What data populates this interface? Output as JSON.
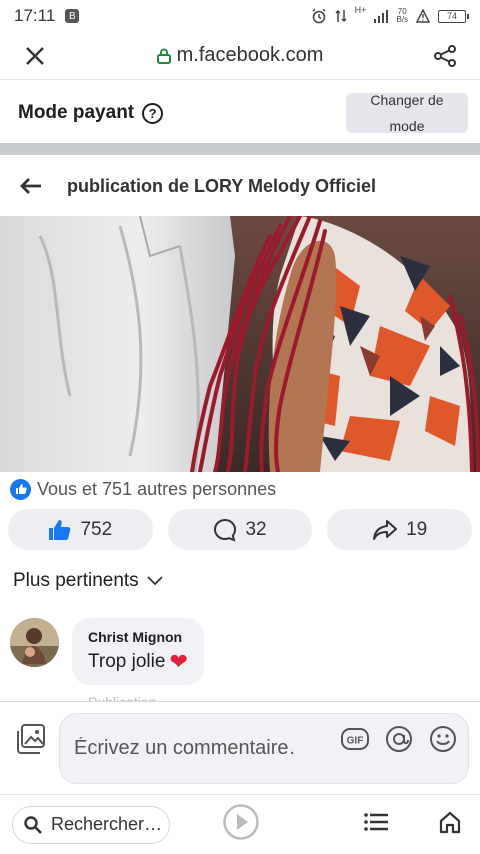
{
  "status_bar": {
    "time": "17:11",
    "app_badge": "B",
    "network_type": "H+",
    "net_speed_value": "70",
    "net_speed_unit": "B/s",
    "battery": "74"
  },
  "browser": {
    "url": "m.facebook.com"
  },
  "mode_bar": {
    "title": "Mode payant",
    "help_icon": "question-circle-icon",
    "button_line1": "Changer de",
    "button_line2": "mode"
  },
  "post": {
    "title": "publication de LORY Melody Officiel",
    "reaction_summary": "Vous et 751 autres personnes",
    "like_count": "752",
    "comment_count": "32",
    "share_count": "19"
  },
  "comments": {
    "sort_label": "Plus pertinents",
    "items": [
      {
        "author": "Christ Mignon",
        "text": "Trop jolie",
        "emoji": "❤"
      }
    ],
    "partial_hint": "Publication"
  },
  "composer": {
    "placeholder": "Écrivez un commentaire…",
    "gif_label": "GIF",
    "mention_label": "@"
  },
  "bottom_bar": {
    "search_label": "Rechercher…"
  },
  "colors": {
    "facebook_blue": "#1877f2",
    "lock_green": "#1e8e3e",
    "heart_red": "#e41e3f"
  }
}
